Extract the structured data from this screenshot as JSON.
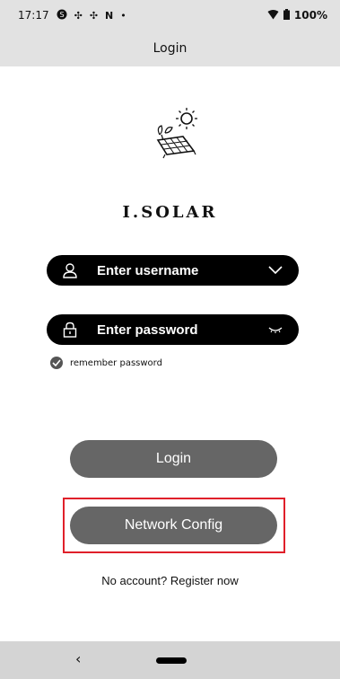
{
  "status_bar": {
    "time": "17:17",
    "battery": "100%",
    "icons": [
      "s-icon",
      "fan-icon",
      "fan-icon",
      "n-icon",
      "dot-icon",
      "wifi-icon",
      "battery-icon"
    ]
  },
  "header": {
    "title": "Login"
  },
  "brand": {
    "name": "I.SOLAR",
    "logo_icon": "solar-panel-sun-icon"
  },
  "form": {
    "username_placeholder": "Enter username",
    "password_placeholder": "Enter password",
    "remember_label": "remember password",
    "remember_checked": true
  },
  "buttons": {
    "login_label": "Login",
    "network_config_label": "Network Config"
  },
  "footer": {
    "register_text": "No account? Register now"
  },
  "colors": {
    "bar_bg": "#e2e2e2",
    "input_bg": "#000000",
    "button_bg": "#666666",
    "highlight": "#e0202a"
  }
}
